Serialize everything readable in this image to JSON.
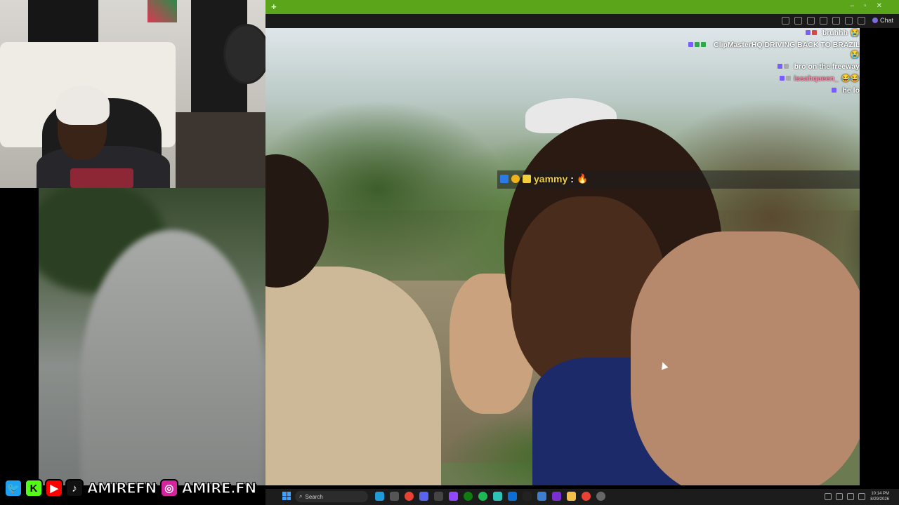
{
  "chat": {
    "messages": [
      {
        "user": "",
        "text": "bruhhh",
        "user_color": "#ff3b3b",
        "emote": "😭"
      },
      {
        "user": "ClipMasterHQ",
        "text": "DRIVING BACK TO BRAZIL",
        "user_color": "#ffffff",
        "emote": "😭"
      },
      {
        "user": "",
        "text": "bro on the freeway",
        "user_color": "#ff3b3b",
        "emote": ""
      },
      {
        "user": "issahqueen_",
        "text": "",
        "user_color": "#ff88a8",
        "emote": "😂😂"
      },
      {
        "user": "",
        "text": "he lo",
        "user_color": "#8a5cff",
        "emote": ""
      }
    ]
  },
  "highlight": {
    "user": "yammy",
    "separator": ":",
    "emote": "🔥",
    "name_color": "#f0cf3a"
  },
  "social": {
    "handle_one": "AMIREFN",
    "handle_two": "AMIRE.FN",
    "twitter_icon": "🐦",
    "kick_icon": "K",
    "youtube_icon": "▶",
    "tiktok_icon": "♪",
    "instagram_icon": "◎",
    "twitter_color": "#1da1f2",
    "kick_color": "#53fc18",
    "youtube_color": "#ff0000",
    "tiktok_color": "#111111",
    "instagram_color": "#d6249f"
  },
  "browser": {
    "new_tab_icon": "+",
    "chat_label": "Chat"
  },
  "taskbar": {
    "search_placeholder": "Search",
    "time": "10:14 PM",
    "date": "8/29/2026"
  }
}
